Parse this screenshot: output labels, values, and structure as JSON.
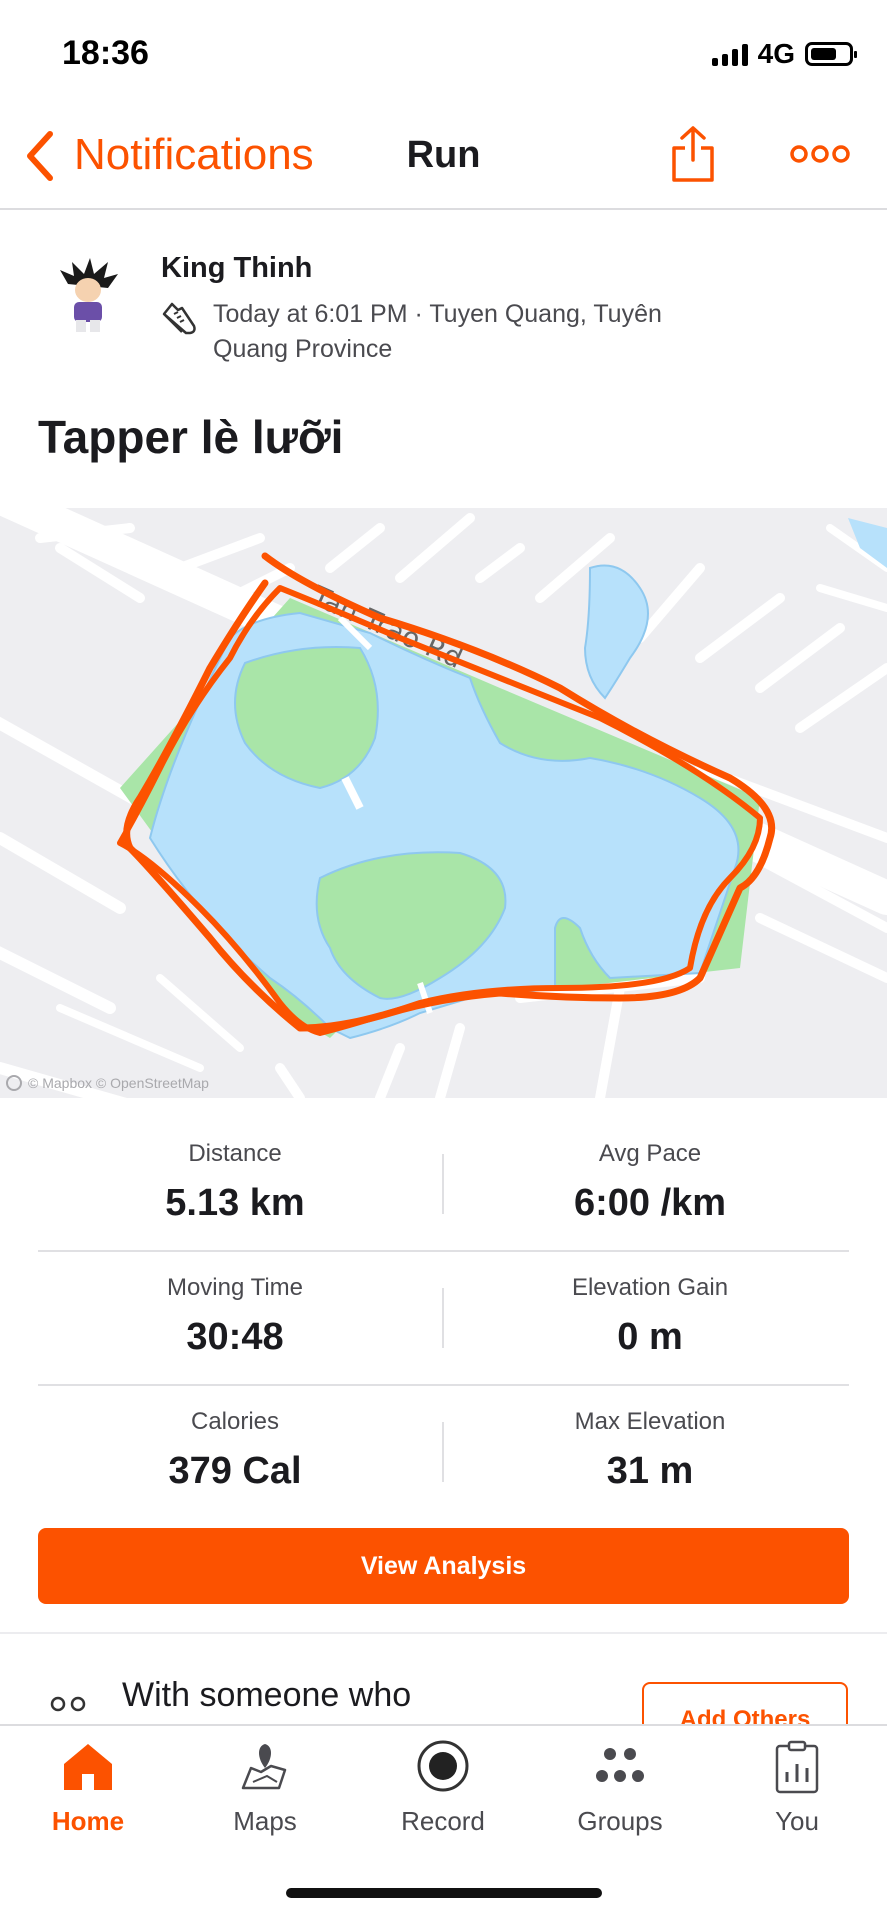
{
  "status_bar": {
    "time": "18:36",
    "network": "4G"
  },
  "nav": {
    "back_label": "Notifications",
    "title": "Run"
  },
  "athlete": {
    "name": "King Thinh",
    "meta": "Today at 6:01 PM · Tuyen Quang, Tuyên Quang Province"
  },
  "activity": {
    "title": "Tapper lè lưỡi"
  },
  "map": {
    "road_label": "Tan Trao Rd",
    "attribution": "© Mapbox © OpenStreetMap",
    "route_color": "#fc5200",
    "water_color": "#b7e1fb",
    "park_color": "#a9e5a8"
  },
  "stats": [
    {
      "label": "Distance",
      "value": "5.13 km"
    },
    {
      "label": "Avg Pace",
      "value": "6:00 /km"
    },
    {
      "label": "Moving Time",
      "value": "30:48"
    },
    {
      "label": "Elevation Gain",
      "value": "0 m"
    },
    {
      "label": "Calories",
      "value": "379 Cal"
    },
    {
      "label": "Max Elevation",
      "value": "31 m"
    }
  ],
  "buttons": {
    "view_analysis": "View Analysis",
    "add_others": "Add Others"
  },
  "with_others": {
    "text": "With someone who"
  },
  "tabs": [
    {
      "label": "Home",
      "icon": "home-icon",
      "active": true
    },
    {
      "label": "Maps",
      "icon": "maps-icon",
      "active": false
    },
    {
      "label": "Record",
      "icon": "record-icon",
      "active": false
    },
    {
      "label": "Groups",
      "icon": "groups-icon",
      "active": false
    },
    {
      "label": "You",
      "icon": "you-icon",
      "active": false
    }
  ],
  "colors": {
    "accent": "#fc5200"
  }
}
